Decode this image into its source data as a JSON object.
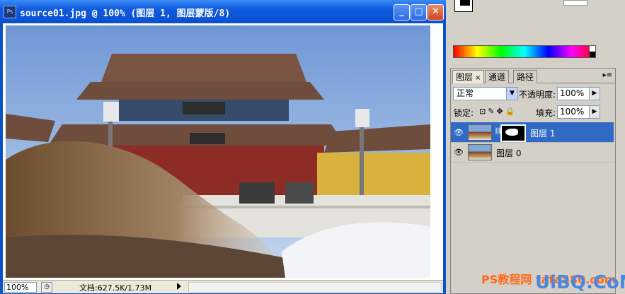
{
  "window": {
    "title": "source01.jpg @ 100% (图层 1, 图层蒙版/8)",
    "app_icon": "Ps",
    "minimize": "_",
    "maximize": "□",
    "close": "✕"
  },
  "status": {
    "zoom": "100%",
    "doc_info": "文档:627.5K/1.73M"
  },
  "layers_panel": {
    "tabs": [
      {
        "label": "图层",
        "close": "×"
      },
      {
        "label": "通道"
      },
      {
        "label": "路径"
      }
    ],
    "blend_mode": "正常",
    "opacity_label": "不透明度:",
    "opacity_value": "100%",
    "lock_label": "锁定:",
    "fill_label": "填充:",
    "fill_value": "100%",
    "layers": [
      {
        "name": "图层 1",
        "selected": true,
        "has_mask": true
      },
      {
        "name": "图层 0",
        "selected": false,
        "has_mask": false
      }
    ]
  },
  "watermark": {
    "site_cn": "PS教程网",
    "site_url": "tata580.com",
    "brand": "UiBQ.CoM"
  }
}
